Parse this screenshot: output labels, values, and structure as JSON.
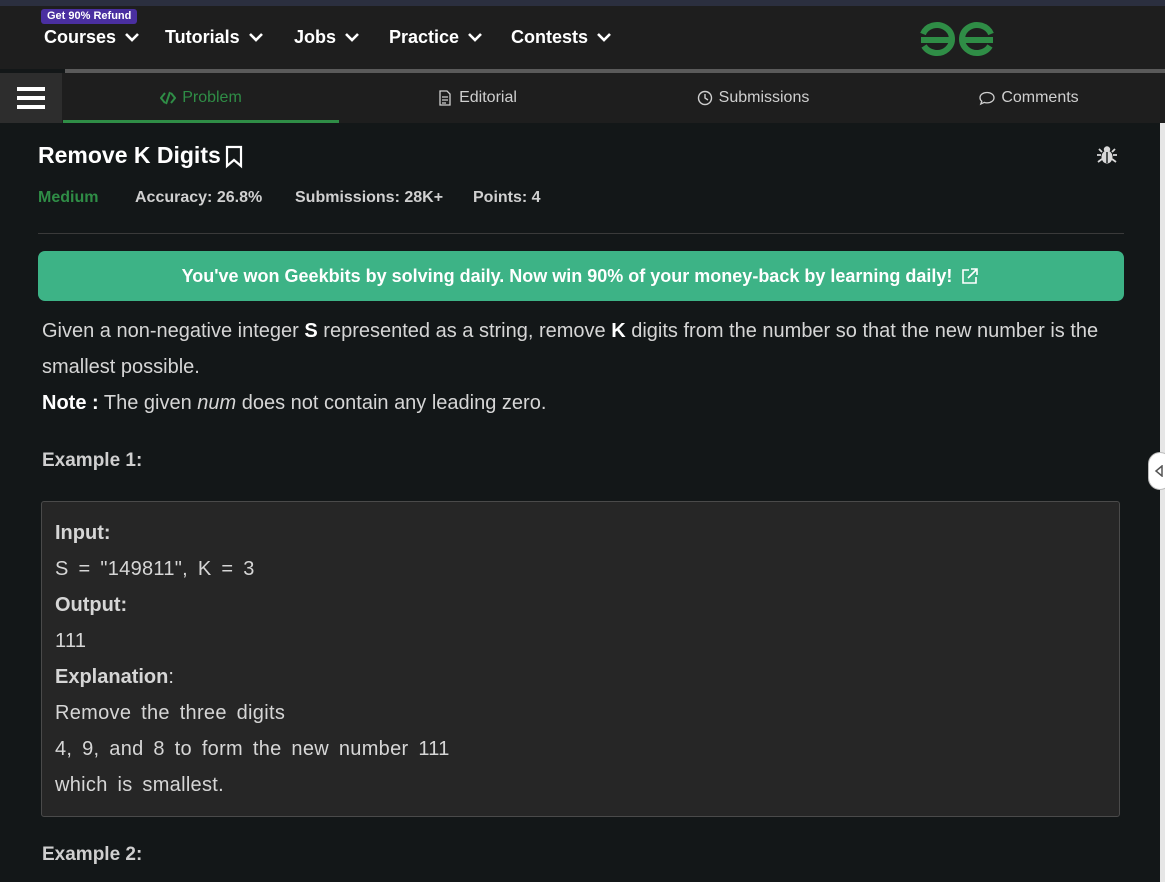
{
  "nav": {
    "refund_badge": "Get 90% Refund",
    "items": [
      "Courses",
      "Tutorials",
      "Jobs",
      "Practice",
      "Contests"
    ],
    "logo_color": "#2f8d46"
  },
  "tabs": [
    {
      "label": "Problem",
      "icon": "code-icon",
      "active": true
    },
    {
      "label": "Editorial",
      "icon": "document-icon"
    },
    {
      "label": "Submissions",
      "icon": "clock-icon"
    },
    {
      "label": "Comments",
      "icon": "comment-icon"
    }
  ],
  "problem": {
    "title": "Remove K Digits",
    "difficulty": "Medium",
    "accuracy": "Accuracy: 26.8%",
    "submissions": "Submissions: 28K+",
    "points": "Points: 4"
  },
  "banner": {
    "text": "You've won Geekbits by solving daily. Now win 90% of your money-back by learning daily!",
    "color": "#3db386"
  },
  "description": {
    "p1_a": "Given a non-negative integer ",
    "p1_s": "S",
    "p1_b": " represented as a string, remove ",
    "p1_k": "K",
    "p1_c": " digits from the number so that the new number is the smallest possible.",
    "note_label": "Note :",
    "note_a": " The given ",
    "note_em": "num",
    "note_b": " does not contain any leading zero."
  },
  "example1": {
    "heading": "Example 1:",
    "input_label": "Input:",
    "input_value": "S = \"149811\", K = 3",
    "output_label": "Output:",
    "output_value": "111",
    "explanation_label": "Explanation",
    "explanation_colon": ":",
    "explanation_lines": [
      "Remove the three digits",
      "4, 9, and 8 to form the new number 111",
      "which is smallest."
    ]
  },
  "example2": {
    "heading": "Example 2:"
  },
  "colors": {
    "accent_green": "#2f8d46",
    "background": "#131718",
    "panel": "#1e1e1e"
  }
}
